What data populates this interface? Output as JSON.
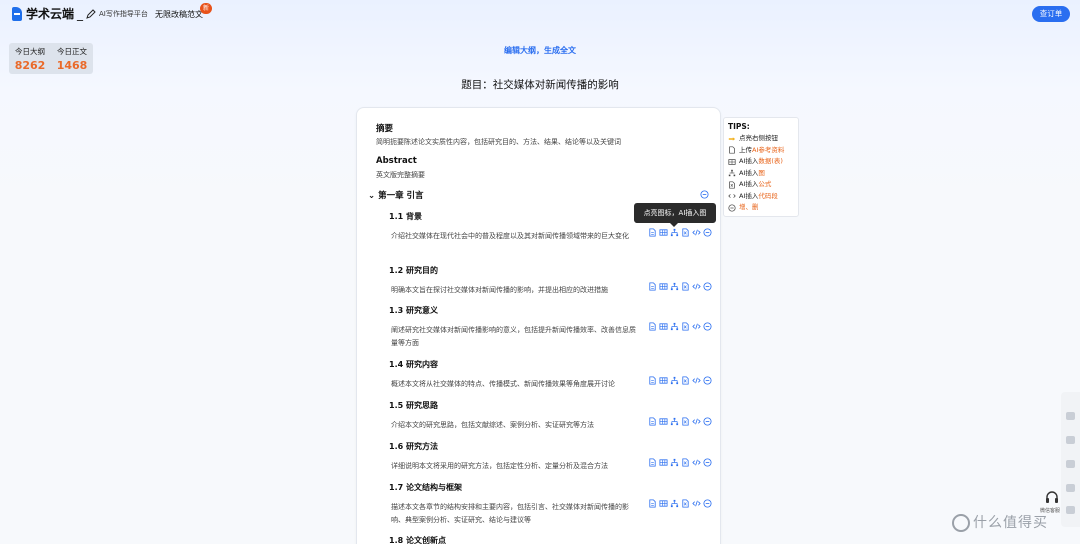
{
  "header": {
    "logo_text": "学术云端",
    "logo_sep": "_",
    "logo_sub": "AI写作指导平台",
    "nav_free": "无限改稿范文",
    "new_badge": "新",
    "order_button": "查订单"
  },
  "stats": [
    {
      "label": "今日大纲",
      "value": "8262"
    },
    {
      "label": "今日正文",
      "value": "1468"
    }
  ],
  "page": {
    "edit_title": "编辑大纲，生成全文",
    "doc_title": "题目：社交媒体对新闻传播的影响"
  },
  "abstract": {
    "zh_heading": "摘要",
    "zh_desc": "简明扼要陈述论文实质性内容，包括研究目的、方法、结果、结论等以及关键词",
    "en_heading": "Abstract",
    "en_desc": "英文版完整摘要"
  },
  "chapter": {
    "title": "第一章 引言",
    "sections": [
      {
        "title": "1.1  背景",
        "desc": "介绍社交媒体在现代社会中的普及程度以及其对新闻传播领域带来的巨大变化"
      },
      {
        "title": "1.2  研究目的",
        "desc": "明确本文旨在探讨社交媒体对新闻传播的影响，并提出相应的改进措施"
      },
      {
        "title": "1.3  研究意义",
        "desc": "阐述研究社交媒体对新闻传播影响的意义，包括提升新闻传播效率、改善信息质量等方面"
      },
      {
        "title": "1.4  研究内容",
        "desc": "概述本文将从社交媒体的特点、传播模式、新闻传播效果等角度展开讨论"
      },
      {
        "title": "1.5  研究思路",
        "desc": "介绍本文的研究思路，包括文献综述、案例分析、实证研究等方法"
      },
      {
        "title": "1.6  研究方法",
        "desc": "详细说明本文将采用的研究方法，包括定性分析、定量分析及混合方法"
      },
      {
        "title": "1.7  论文结构与框架",
        "desc": "描述本文各章节的结构安排和主要内容，包括引言、社交媒体对新闻传播的影响、典型案例分析、实证研究、结论与建议等"
      },
      {
        "title": "1.8  论文创新点",
        "desc": ""
      }
    ]
  },
  "tooltip": "点亮图标，AI插入图",
  "tips": {
    "heading": "TIPS:",
    "items": [
      {
        "icon": "pointing-hand-icon",
        "prefix": "",
        "highlight": "",
        "text": "点亮右侧按钮"
      },
      {
        "icon": "document-icon",
        "prefix": "上传",
        "highlight": "AI参考资料",
        "text": ""
      },
      {
        "icon": "table-icon",
        "prefix": "AI插入",
        "highlight": "数据(表)",
        "text": ""
      },
      {
        "icon": "diagram-icon",
        "prefix": "AI插入",
        "highlight": "图",
        "text": ""
      },
      {
        "icon": "formula-icon",
        "prefix": "AI插入",
        "highlight": "公式",
        "text": ""
      },
      {
        "icon": "code-icon",
        "prefix": "AI插入",
        "highlight": "代码段",
        "text": ""
      },
      {
        "icon": "minus-circle-icon",
        "prefix": "",
        "highlight": "增、删",
        "text": ""
      }
    ]
  },
  "side": {
    "headset_label": "微信客服"
  },
  "watermark": "什么值得买",
  "colors": {
    "accent": "#2a6ef0",
    "highlight": "#e8641a",
    "stat_value": "#ea6a2a"
  }
}
